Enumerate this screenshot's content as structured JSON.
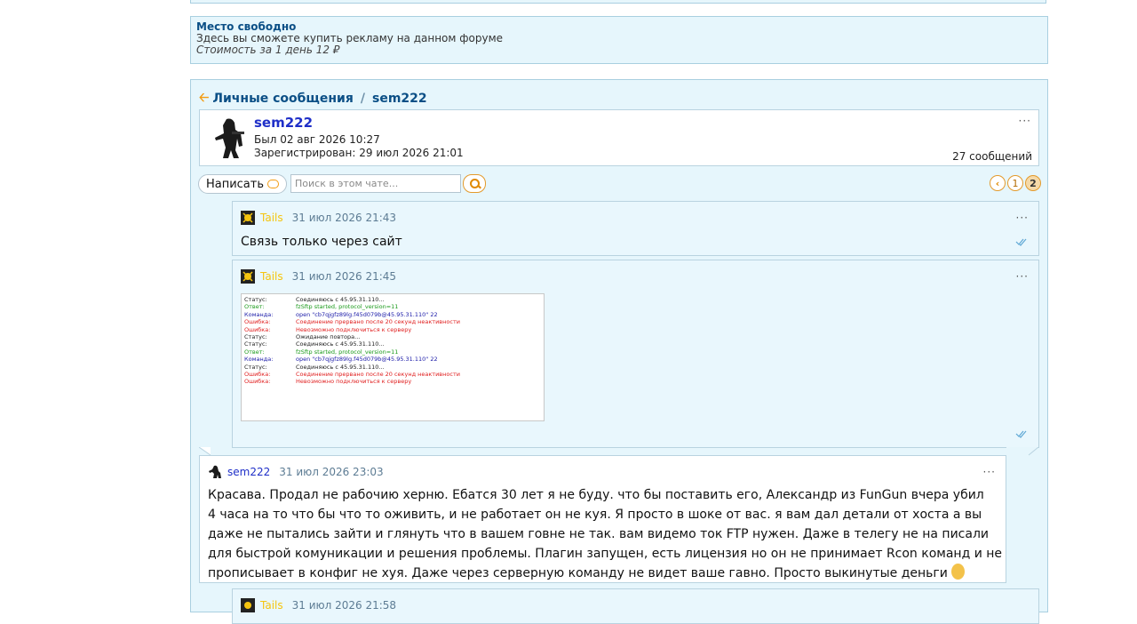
{
  "ad": {
    "title": "Место свободно",
    "description": "Здесь вы сможете купить рекламу на данном форуме",
    "price": "Стоимость за 1 день 12 ₽"
  },
  "breadcrumb": {
    "section": "Личные сообщения",
    "separator": "/",
    "user": "sem222"
  },
  "profile": {
    "name": "sem222",
    "last_seen": "Был 02 авг 2026 10:27",
    "registered": "Зарегистрирован: 29 июл 2026 21:01",
    "message_count": "27 сообщений",
    "menu": "···"
  },
  "toolbar": {
    "write_label": "Написать",
    "search_placeholder": "Поиск в этом чате...",
    "pages": [
      "1",
      "2"
    ],
    "current_page": "2"
  },
  "messages": [
    {
      "author": "Tails",
      "date": "31 июл 2026 21:43",
      "text": "Связь только через сайт",
      "menu": "···"
    },
    {
      "author": "Tails",
      "date": "31 июл 2026 21:45",
      "menu": "···",
      "attachment_log": [
        {
          "label": "Статус:",
          "text": "Соединяюсь с 45.95.31.110...",
          "color": "#222222"
        },
        {
          "label": "Ответ:",
          "text": "fzSftp started, protocol_version=11",
          "color": "#1a9a1a"
        },
        {
          "label": "Команда:",
          "text": "open \"cb7qjgfz89lg.f45d079b@45.95.31.110\" 22",
          "color": "#1a1aa8"
        },
        {
          "label": "Ошибка:",
          "text": "Соединение прервано после 20 секунд неактивности",
          "color": "#e02020"
        },
        {
          "label": "Ошибка:",
          "text": "Невозможно подключиться к серверу",
          "color": "#e02020"
        },
        {
          "label": "Статус:",
          "text": "Ожидание повтора...",
          "color": "#222222"
        },
        {
          "label": "Статус:",
          "text": "Соединяюсь с 45.95.31.110...",
          "color": "#222222"
        },
        {
          "label": "Ответ:",
          "text": "fzSftp started, protocol_version=11",
          "color": "#1a9a1a"
        },
        {
          "label": "Команда:",
          "text": "open \"cb7qjgfz89lg.f45d079b@45.95.31.110\" 22",
          "color": "#1a1aa8"
        },
        {
          "label": "Статус:",
          "text": "Соединяюсь с 45.95.31.110...",
          "color": "#222222"
        },
        {
          "label": "Ошибка:",
          "text": "Соединение прервано после 20 секунд неактивности",
          "color": "#e02020"
        },
        {
          "label": "Ошибка:",
          "text": "Невозможно подключиться к серверу",
          "color": "#e02020"
        }
      ]
    },
    {
      "author": "sem222",
      "date": "31 июл 2026 23:03",
      "menu": "···",
      "text_lines": [
        "Красава. Продал не рабочию херню. Ебатся 30 лет я не буду. что бы поставить его, Александр из FunGun вчера убил",
        "4 часа на то что бы что то оживить, и не работает он не куя. Я просто в шоке от вас. я вам дал детали от хоста а вы",
        "даже не пытались зайти и глянуть что в вашем говне не так. вам видемо ток FTP нужен. Даже в телегу не на писали",
        "для быстрой комуникации и решения проблемы. Плагин запущен, есть лицензия но он не принимает Rcon команд и не",
        "прописывает в конфиг не хуя. Даже через серверную команду не видет ваше гавно. Просто выкинутые деньги"
      ]
    },
    {
      "author": "Tails",
      "date": "31 июл 2026 21:58"
    }
  ],
  "colors": {
    "panel_bg": "#e6f6fc",
    "panel_border": "#a9cfe0",
    "link": "#0b4f86",
    "username": "#1f2fc8",
    "tails": "#f5c40f",
    "accent": "#f39c12"
  }
}
